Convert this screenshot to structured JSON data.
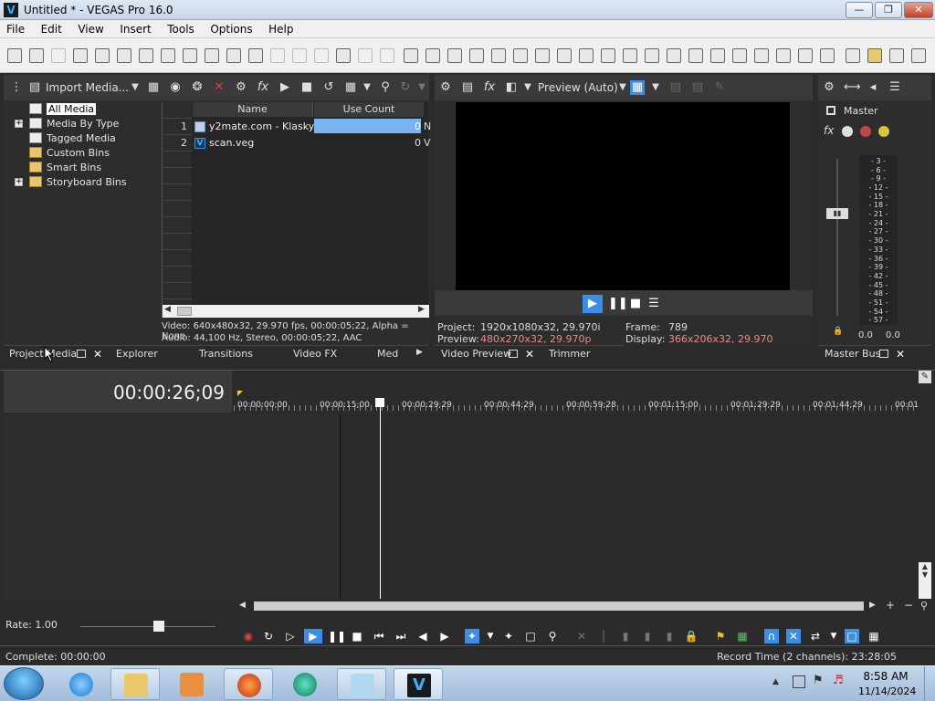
{
  "window": {
    "title": "Untitled * - VEGAS Pro 16.0",
    "app_icon": "V"
  },
  "menu": [
    "File",
    "Edit",
    "View",
    "Insert",
    "Tools",
    "Options",
    "Help"
  ],
  "project_media": {
    "import_label": "Import Media...",
    "tree": [
      "All Media",
      "Media By Type",
      "Tagged Media",
      "Custom Bins",
      "Smart Bins",
      "Storyboard Bins"
    ],
    "columns": {
      "name": "Name",
      "use_count": "Use Count"
    },
    "rows": [
      {
        "num": "1",
        "name": "y2mate.com - Klasky...",
        "count": "0",
        "extra": "N"
      },
      {
        "num": "2",
        "name": "scan.veg",
        "count": "0",
        "extra": "V"
      }
    ],
    "video_info": "Video: 640x480x32, 29.970 fps, 00:00:05;22, Alpha = None",
    "audio_info": "Audio: 44,100 Hz, Stereo, 00:00:05;22, AAC"
  },
  "left_tabs": [
    "Project Media",
    "Explorer",
    "Transitions",
    "Video FX",
    "Med"
  ],
  "video_preview": {
    "mode": "Preview (Auto)",
    "project_label": "Project:",
    "project_value": "1920x1080x32, 29.970i",
    "preview_label": "Preview:",
    "preview_value": "480x270x32, 29.970p",
    "frame_label": "Frame:",
    "frame_value": "789",
    "display_label": "Display:",
    "display_value": "366x206x32, 29.970",
    "tabs": [
      "Video Preview",
      "Trimmer"
    ]
  },
  "master": {
    "label": "Master",
    "scale": [
      "3",
      "6",
      "9",
      "12",
      "15",
      "18",
      "21",
      "24",
      "27",
      "30",
      "33",
      "36",
      "39",
      "42",
      "45",
      "48",
      "51",
      "54",
      "57"
    ],
    "left_value": "0.0",
    "right_value": "0.0",
    "tab": "Master Bus"
  },
  "timeline": {
    "timecode": "00:00:26;09",
    "ruler": [
      "00:00:00;00",
      "00:00:15;00",
      "00:00:29;29",
      "00:00:44;29",
      "00:00:59;28",
      "00:01:15;00",
      "00:01:29;29",
      "00:01:44;29",
      "00:01"
    ],
    "rate": "Rate: 1.00"
  },
  "status": {
    "left": "Complete: 00:00:00",
    "right": "Record Time (2 channels): 23:28:05"
  },
  "taskbar": {
    "time": "8:58 AM",
    "date": "11/14/2024"
  },
  "colors": {
    "accent_blue": "#3a8ee6",
    "highlight_red": "#e88a8a"
  }
}
